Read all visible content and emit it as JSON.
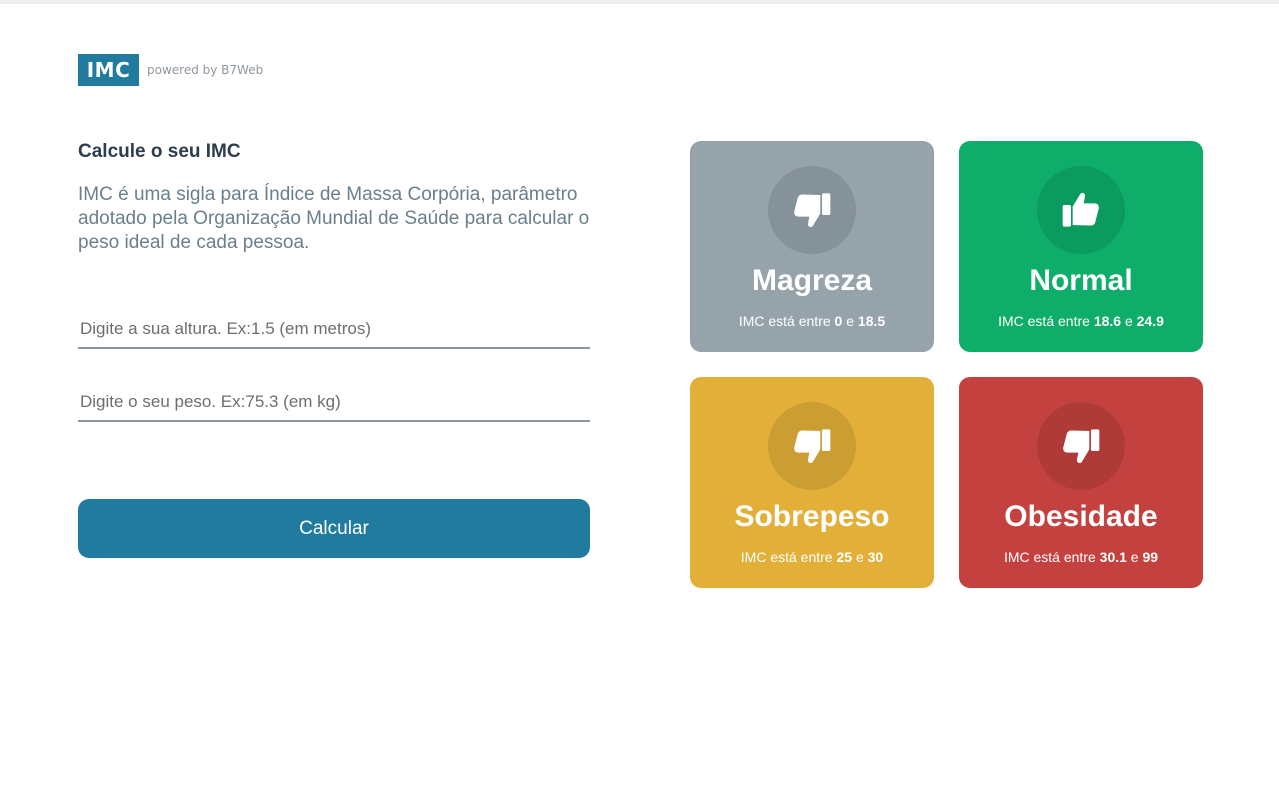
{
  "header": {
    "logo": "IMC",
    "powered_by": "powered by B7Web"
  },
  "left": {
    "title": "Calcule o seu IMC",
    "description": "IMC é uma sigla para Índice de Massa Corpória, parâmetro adotado pela Organização Mundial de Saúde para calcular o peso ideal de cada pessoa.",
    "height_input": {
      "placeholder": "Digite a sua altura. Ex:1.5 (em metros)",
      "value": ""
    },
    "weight_input": {
      "placeholder": "Digite o seu peso. Ex:75.3 (em kg)",
      "value": ""
    },
    "button_label": "Calcular"
  },
  "levels": [
    {
      "title": "Magreza",
      "icon": "thumbs-down-icon",
      "color": "#96a3ab",
      "range_prefix": "IMC está entre",
      "min": "0",
      "joiner": "e",
      "max": "18.5"
    },
    {
      "title": "Normal",
      "icon": "thumbs-up-icon",
      "color": "#0ead69",
      "range_prefix": "IMC está entre",
      "min": "18.6",
      "joiner": "e",
      "max": "24.9"
    },
    {
      "title": "Sobrepeso",
      "icon": "thumbs-down-icon",
      "color": "#e2b039",
      "range_prefix": "IMC está entre",
      "min": "25",
      "joiner": "e",
      "max": "30"
    },
    {
      "title": "Obesidade",
      "icon": "thumbs-down-icon",
      "color": "#c3423f",
      "range_prefix": "IMC está entre",
      "min": "30.1",
      "joiner": "e",
      "max": "99"
    }
  ]
}
